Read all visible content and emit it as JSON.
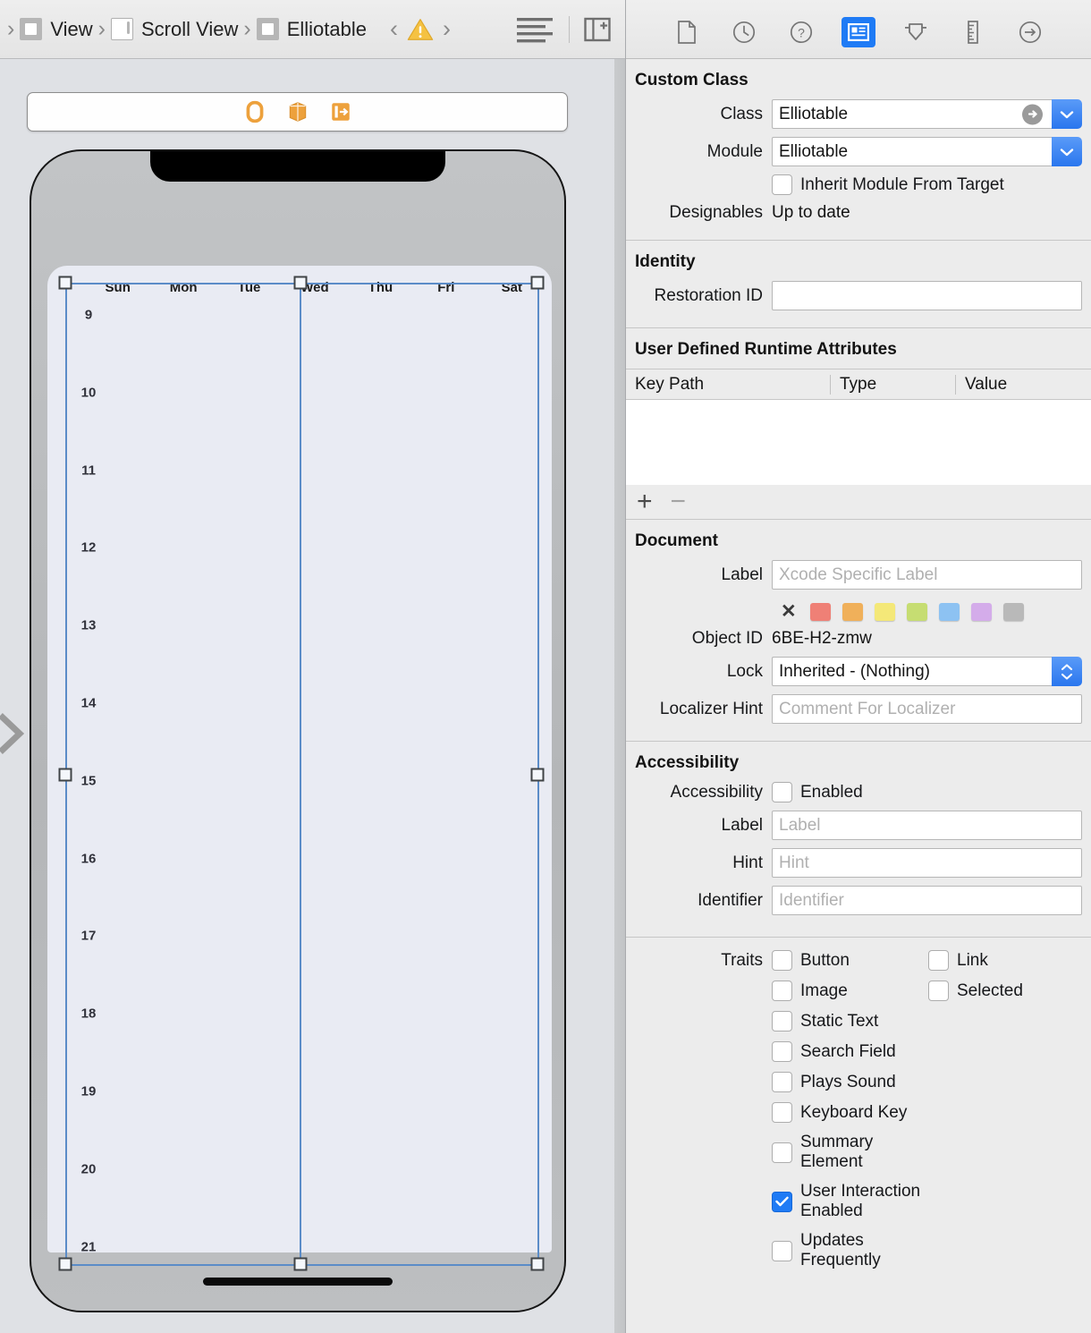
{
  "jump_bar": {
    "crumbs": [
      {
        "label": "View",
        "icon": "view-icon"
      },
      {
        "label": "Scroll View",
        "icon": "scroll-view-icon"
      },
      {
        "label": "Elliotable",
        "icon": "view-icon"
      }
    ],
    "prev_label": "‹",
    "next_label": "›",
    "warning_icon": "warning-triangle-icon",
    "lines_icon": "document-items-icon",
    "add_pane_icon": "add-editor-pane-icon"
  },
  "scene_dock": {
    "items": [
      {
        "name": "view-controller-icon"
      },
      {
        "name": "first-responder-icon"
      },
      {
        "name": "exit-icon"
      }
    ]
  },
  "canvas": {
    "days": [
      "Sun",
      "Mon",
      "Tue",
      "Wed",
      "Thu",
      "Fri",
      "Sat"
    ],
    "hours": [
      "9",
      "10",
      "11",
      "12",
      "13",
      "14",
      "15",
      "16",
      "17",
      "18",
      "19",
      "20",
      "21"
    ],
    "expand_arrow_icon": "chevron-right-icon"
  },
  "inspector": {
    "tabs": [
      {
        "name": "file-inspector-icon",
        "selected": false
      },
      {
        "name": "history-inspector-icon",
        "selected": false
      },
      {
        "name": "quick-help-inspector-icon",
        "selected": false
      },
      {
        "name": "identity-inspector-icon",
        "selected": true
      },
      {
        "name": "attributes-inspector-icon",
        "selected": false
      },
      {
        "name": "size-inspector-icon",
        "selected": false
      },
      {
        "name": "connections-inspector-icon",
        "selected": false
      }
    ],
    "custom_class": {
      "title": "Custom Class",
      "class_label": "Class",
      "class_value": "Elliotable",
      "module_label": "Module",
      "module_value": "Elliotable",
      "inherit_label": "Inherit Module From Target",
      "inherit_checked": false,
      "designables_label": "Designables",
      "designables_value": "Up to date"
    },
    "identity": {
      "title": "Identity",
      "restoration_label": "Restoration ID",
      "restoration_value": "",
      "restoration_placeholder": ""
    },
    "runtime_attrs": {
      "title": "User Defined Runtime Attributes",
      "columns": [
        "Key Path",
        "Type",
        "Value"
      ],
      "rows": [],
      "add_label": "+",
      "remove_label": "−"
    },
    "document": {
      "title": "Document",
      "label_label": "Label",
      "label_value": "",
      "label_placeholder": "Xcode Specific Label",
      "clear_color_label": "✕",
      "colors": [
        "#ef8076",
        "#f0b05a",
        "#f4e878",
        "#c6dd72",
        "#8dc2f2",
        "#d4acea",
        "#b9b9b9"
      ],
      "object_id_label": "Object ID",
      "object_id_value": "6BE-H2-zmw",
      "lock_label": "Lock",
      "lock_value": "Inherited - (Nothing)",
      "localizer_label": "Localizer Hint",
      "localizer_value": "",
      "localizer_placeholder": "Comment For Localizer"
    },
    "accessibility": {
      "title": "Accessibility",
      "enabled_label": "Accessibility",
      "enabled_text": "Enabled",
      "enabled_checked": false,
      "label_label": "Label",
      "label_placeholder": "Label",
      "hint_label": "Hint",
      "hint_placeholder": "Hint",
      "identifier_label": "Identifier",
      "identifier_placeholder": "Identifier",
      "traits_label": "Traits",
      "traits": [
        {
          "label": "Button",
          "checked": false
        },
        {
          "label": "Link",
          "checked": false
        },
        {
          "label": "Image",
          "checked": false
        },
        {
          "label": "Selected",
          "checked": false
        },
        {
          "label": "Static Text",
          "checked": false
        },
        {
          "label": "Search Field",
          "checked": false
        },
        {
          "label": "Plays Sound",
          "checked": false
        },
        {
          "label": "Keyboard Key",
          "checked": false
        },
        {
          "label": "Summary Element",
          "checked": false
        },
        {
          "label": "User Interaction Enabled",
          "checked": true
        },
        {
          "label": "Updates Frequently",
          "checked": false
        }
      ]
    }
  },
  "colors": {
    "accent_blue": "#1f7bf5",
    "selection_blue": "#5b8cc8",
    "warning_amber": "#f5c242",
    "dock_orange": "#eda13c",
    "inspector_bg": "#ececec",
    "canvas_bg": "#dfe1e5"
  }
}
